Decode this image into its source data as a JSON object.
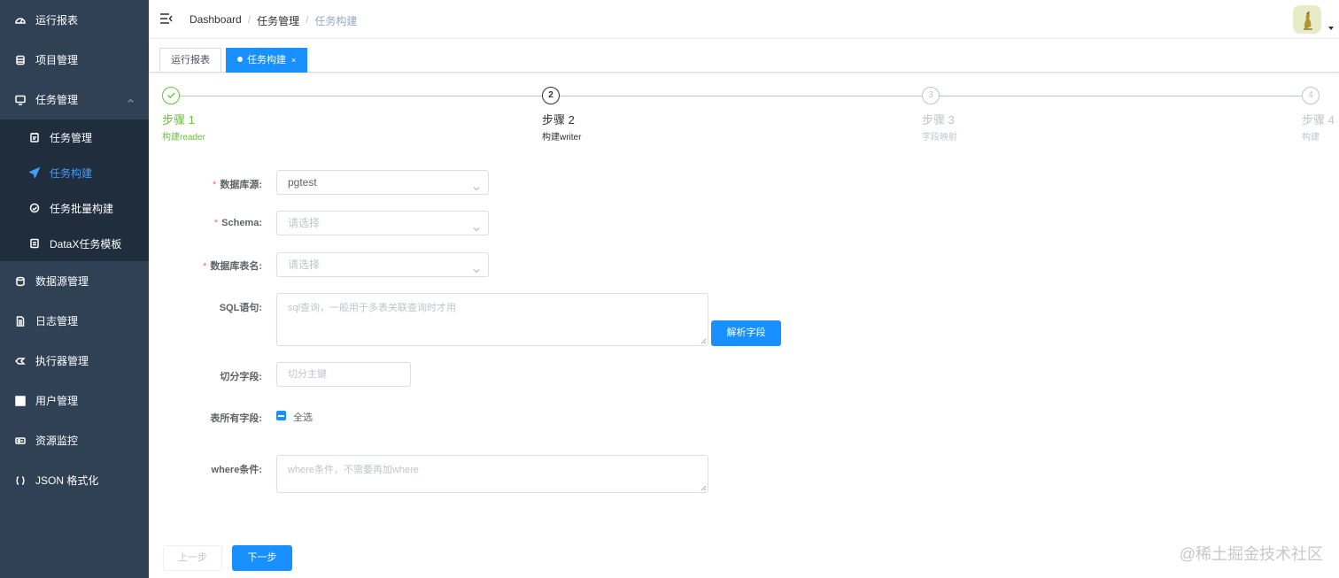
{
  "sidebar": {
    "items": [
      {
        "label": "运行报表",
        "icon": "dashboard-icon"
      },
      {
        "label": "项目管理",
        "icon": "database-icon"
      },
      {
        "label": "任务管理",
        "icon": "monitor-icon"
      },
      {
        "label": "数据源管理",
        "icon": "datasource-icon"
      },
      {
        "label": "日志管理",
        "icon": "document-icon"
      },
      {
        "label": "执行器管理",
        "icon": "executor-icon"
      },
      {
        "label": "用户管理",
        "icon": "grid-icon"
      },
      {
        "label": "资源监控",
        "icon": "monitor-resource-icon"
      },
      {
        "label": "JSON 格式化",
        "icon": "braces-icon"
      }
    ],
    "task_submenu": [
      {
        "label": "任务管理",
        "icon": "calendar-icon"
      },
      {
        "label": "任务构建",
        "icon": "send-icon",
        "active": true
      },
      {
        "label": "任务批量构建",
        "icon": "clock-icon"
      },
      {
        "label": "DataX任务模板",
        "icon": "template-icon"
      }
    ]
  },
  "header": {
    "breadcrumb": [
      "Dashboard",
      "任务管理",
      "任务构建"
    ]
  },
  "tabs": [
    {
      "label": "运行报表"
    },
    {
      "label": "任务构建",
      "active": true,
      "close": "×"
    }
  ],
  "steps": [
    {
      "title": "步骤 1",
      "desc": "构建reader",
      "status": "done"
    },
    {
      "title": "步骤 2",
      "desc": "构建writer",
      "status": "current",
      "num": "2"
    },
    {
      "title": "步骤 3",
      "desc": "字段映射",
      "status": "wait",
      "num": "3"
    },
    {
      "title": "步骤 4",
      "desc": "构建",
      "status": "wait",
      "num": "4"
    }
  ],
  "form": {
    "datasource": {
      "label": "数据库源:",
      "value": "pgtest"
    },
    "schema": {
      "label": "Schema:",
      "placeholder": "请选择"
    },
    "table": {
      "label": "数据库表名:",
      "placeholder": "请选择"
    },
    "sql": {
      "label": "SQL语句:",
      "placeholder": "sql查询，一般用于多表关联查询时才用"
    },
    "parse_button": "解析字段",
    "split": {
      "label": "切分字段:",
      "placeholder": "切分主键"
    },
    "all_fields": {
      "label": "表所有字段:",
      "checkbox_label": "全选"
    },
    "where": {
      "label": "where条件:",
      "placeholder": "where条件，不需要再加where"
    }
  },
  "buttons": {
    "prev": "上一步",
    "next": "下一步"
  },
  "watermark": "@稀土掘金技术社区",
  "colors": {
    "primary": "#1890ff",
    "sidebar": "#304156",
    "success": "#67c23a"
  }
}
